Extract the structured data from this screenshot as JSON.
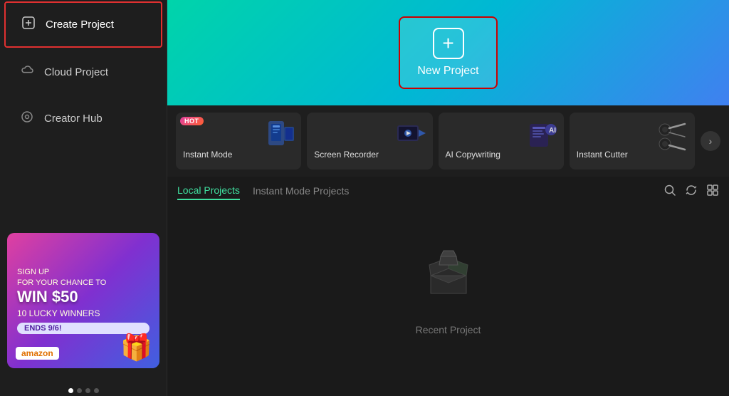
{
  "sidebar": {
    "items": [
      {
        "id": "create-project",
        "label": "Create Project",
        "icon": "⊞",
        "active": true
      },
      {
        "id": "cloud-project",
        "label": "Cloud Project",
        "icon": "☁",
        "active": false
      },
      {
        "id": "creator-hub",
        "label": "Creator Hub",
        "icon": "◎",
        "active": false
      }
    ]
  },
  "banner": {
    "signup_text": "SIGN UP",
    "for_text": "FOR YOUR CHANCE TO",
    "win_text": "WIN $50",
    "lucky_text": "10 LUCKY WINNERS",
    "ends_badge": "ENDS 9/6!",
    "amazon_logo": "amazon",
    "dots": [
      true,
      false,
      false,
      false
    ]
  },
  "hero": {
    "new_project_label": "New Project"
  },
  "tools": {
    "items": [
      {
        "id": "instant-mode",
        "label": "Instant Mode",
        "emoji": "📱",
        "hot": true
      },
      {
        "id": "screen-recorder",
        "label": "Screen Recorder",
        "emoji": "🎬",
        "hot": false
      },
      {
        "id": "ai-copywriting",
        "label": "AI Copywriting",
        "emoji": "🤖",
        "hot": false
      },
      {
        "id": "instant-cutter",
        "label": "Instant Cutter",
        "emoji": "✂",
        "hot": false
      }
    ],
    "arrow_label": "›"
  },
  "tabs": {
    "items": [
      {
        "id": "local-projects",
        "label": "Local Projects",
        "active": true
      },
      {
        "id": "instant-mode-projects",
        "label": "Instant Mode Projects",
        "active": false
      }
    ],
    "actions": {
      "search": "🔍",
      "refresh": "⟳",
      "layout": "⊞"
    }
  },
  "empty_state": {
    "emoji": "📦",
    "label": "Recent Project"
  }
}
